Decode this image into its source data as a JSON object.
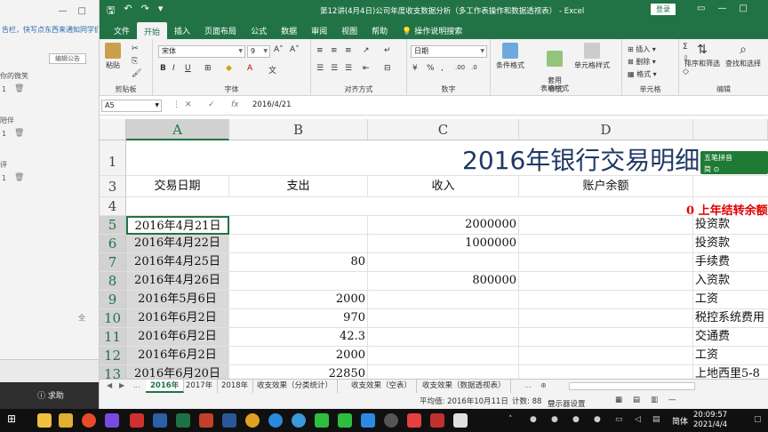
{
  "bg_panel": {
    "notice": "告栏，快写点东西来通知同学们",
    "edit_label": "编辑公告",
    "entries": [
      {
        "label": "你的微笑",
        "count": "1"
      },
      {
        "label": "陪伴",
        "count": "1"
      },
      {
        "label": "评",
        "count": "1"
      }
    ],
    "help_label": "求助",
    "fullscreen_label": "全"
  },
  "titlebar": {
    "title": "第12讲(4月4日)公司年度收支数据分析（多工作表操作和数据透视表） - Excel",
    "login": "登录"
  },
  "tabs": [
    "文件",
    "开始",
    "插入",
    "页面布局",
    "公式",
    "数据",
    "审阅",
    "视图",
    "帮助",
    "操作说明搜索"
  ],
  "ribbon": {
    "paste": "粘贴",
    "clipboard": "剪贴板",
    "font_name": "宋体",
    "font_size": "9",
    "font_group": "字体",
    "align_group": "对齐方式",
    "number_format": "日期",
    "number_group": "数字",
    "cond_format": "条件格式",
    "table_format": "套用\n表格格式",
    "cell_style": "单元格样式",
    "style_group": "样式",
    "insert": "插入",
    "delete": "删除",
    "format": "格式",
    "cells_group": "单元格",
    "sort_filter": "排序和筛选",
    "find_select": "查找和选择",
    "edit_group": "编辑"
  },
  "formula_bar": {
    "name_box": "A5",
    "formula": "2016/4/21"
  },
  "grid": {
    "columns": [
      "A",
      "B",
      "C",
      "D"
    ],
    "row_numbers": [
      "1",
      "3",
      "4",
      "5",
      "6",
      "7",
      "8",
      "9",
      "10",
      "11",
      "12",
      "13"
    ],
    "title": "2016年银行交易明细",
    "headers": [
      "交易日期",
      "支出",
      "收入",
      "账户余额"
    ],
    "opening_balance": "0  上年结转余额",
    "rows": [
      {
        "date": "2016年4月21日",
        "out": "",
        "in": "2000000",
        "note": "投资款"
      },
      {
        "date": "2016年4月22日",
        "out": "",
        "in": "1000000",
        "note": "投资款"
      },
      {
        "date": "2016年4月25日",
        "out": "80",
        "in": "",
        "note": "手续费"
      },
      {
        "date": "2016年4月26日",
        "out": "",
        "in": "800000",
        "note": "入资款"
      },
      {
        "date": "2016年5月6日",
        "out": "2000",
        "in": "",
        "note": "工资"
      },
      {
        "date": "2016年6月2日",
        "out": "970",
        "in": "",
        "note": "税控系统费用"
      },
      {
        "date": "2016年6月2日",
        "out": "42.3",
        "in": "",
        "note": "交通费"
      },
      {
        "date": "2016年6月2日",
        "out": "2000",
        "in": "",
        "note": "工资"
      },
      {
        "date": "2016年6月20日",
        "out": "22850",
        "in": "",
        "note": "上地西里5-8"
      }
    ],
    "ime": {
      "name": "五笔拼音",
      "row2": "简 ⊙"
    }
  },
  "sheet_tabs": {
    "items": [
      "2016年",
      "2017年",
      "2018年",
      "收支效果（分类统计）",
      "收支效果（空表）",
      "收支效果（数据透视表）"
    ],
    "active": "2016年",
    "more": "..."
  },
  "status": {
    "average": "平均值: 2016年10月11日",
    "count": "计数: 88",
    "display": "显示器设置"
  },
  "taskbar": {
    "ime": "简体",
    "time": "20:09:57",
    "date": "2021/4/4"
  },
  "colors": {
    "excel_green": "#217346",
    "title_blue": "#1f3864",
    "red": "#e00000"
  }
}
